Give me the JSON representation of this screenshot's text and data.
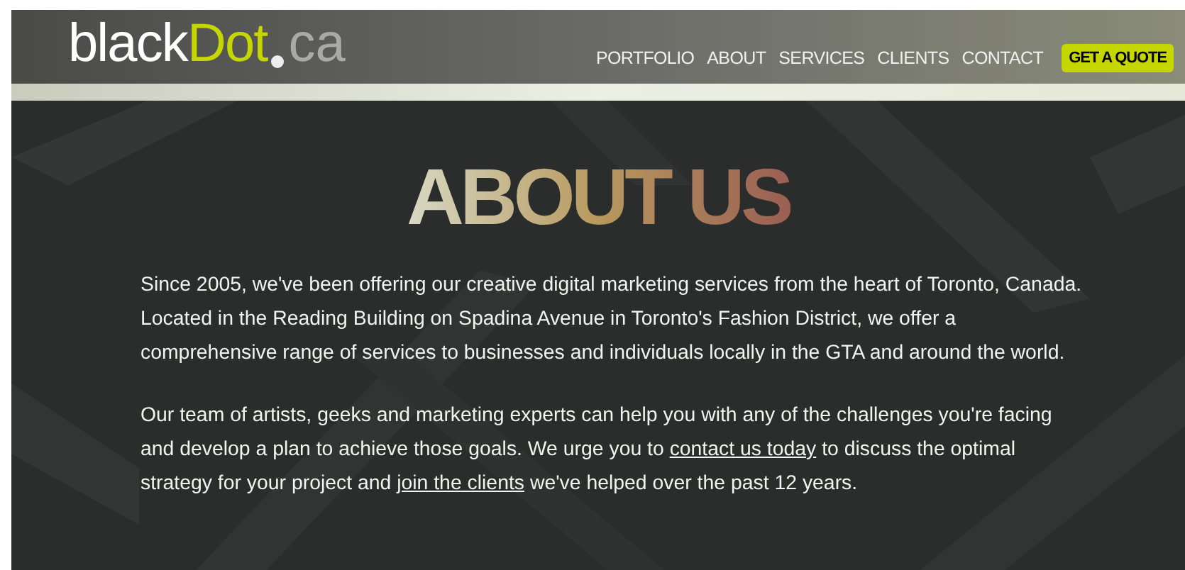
{
  "logo": {
    "parts": [
      {
        "text": "black",
        "color": "#ffffff"
      },
      {
        "text": "Dot",
        "color": "#c5d600"
      },
      {
        "text": "ca",
        "color": "#a9aaa6"
      }
    ]
  },
  "nav": {
    "items": [
      {
        "label": "PORTFOLIO",
        "kind": "link"
      },
      {
        "label": "ABOUT",
        "kind": "link"
      },
      {
        "label": "SERVICES",
        "kind": "link"
      },
      {
        "label": "CLIENTS",
        "kind": "link"
      },
      {
        "label": "CONTACT",
        "kind": "link"
      },
      {
        "label": "GET A QUOTE",
        "kind": "cta"
      }
    ]
  },
  "heading": "ABOUT US",
  "paragraphs": [
    [
      {
        "kind": "text",
        "text": "Since 2005, we've been offering our creative digital marketing services from the heart of Toronto, Canada. Located in the Reading Building on Spadina Avenue in Toronto's Fashion District, we offer a comprehensive range of services to businesses and individuals locally in the GTA and around the world."
      }
    ],
    [
      {
        "kind": "text",
        "text": "Our team of artists, geeks and marketing experts can help you with any of the challenges you're facing and develop a plan to achieve those goals. We urge you to "
      },
      {
        "kind": "link",
        "text": "contact us today"
      },
      {
        "kind": "text",
        "text": " to discuss the optimal strategy for your project and "
      },
      {
        "kind": "link",
        "text": "join the clients"
      },
      {
        "kind": "text",
        "text": " we've helped over the past 12 years."
      }
    ]
  ]
}
